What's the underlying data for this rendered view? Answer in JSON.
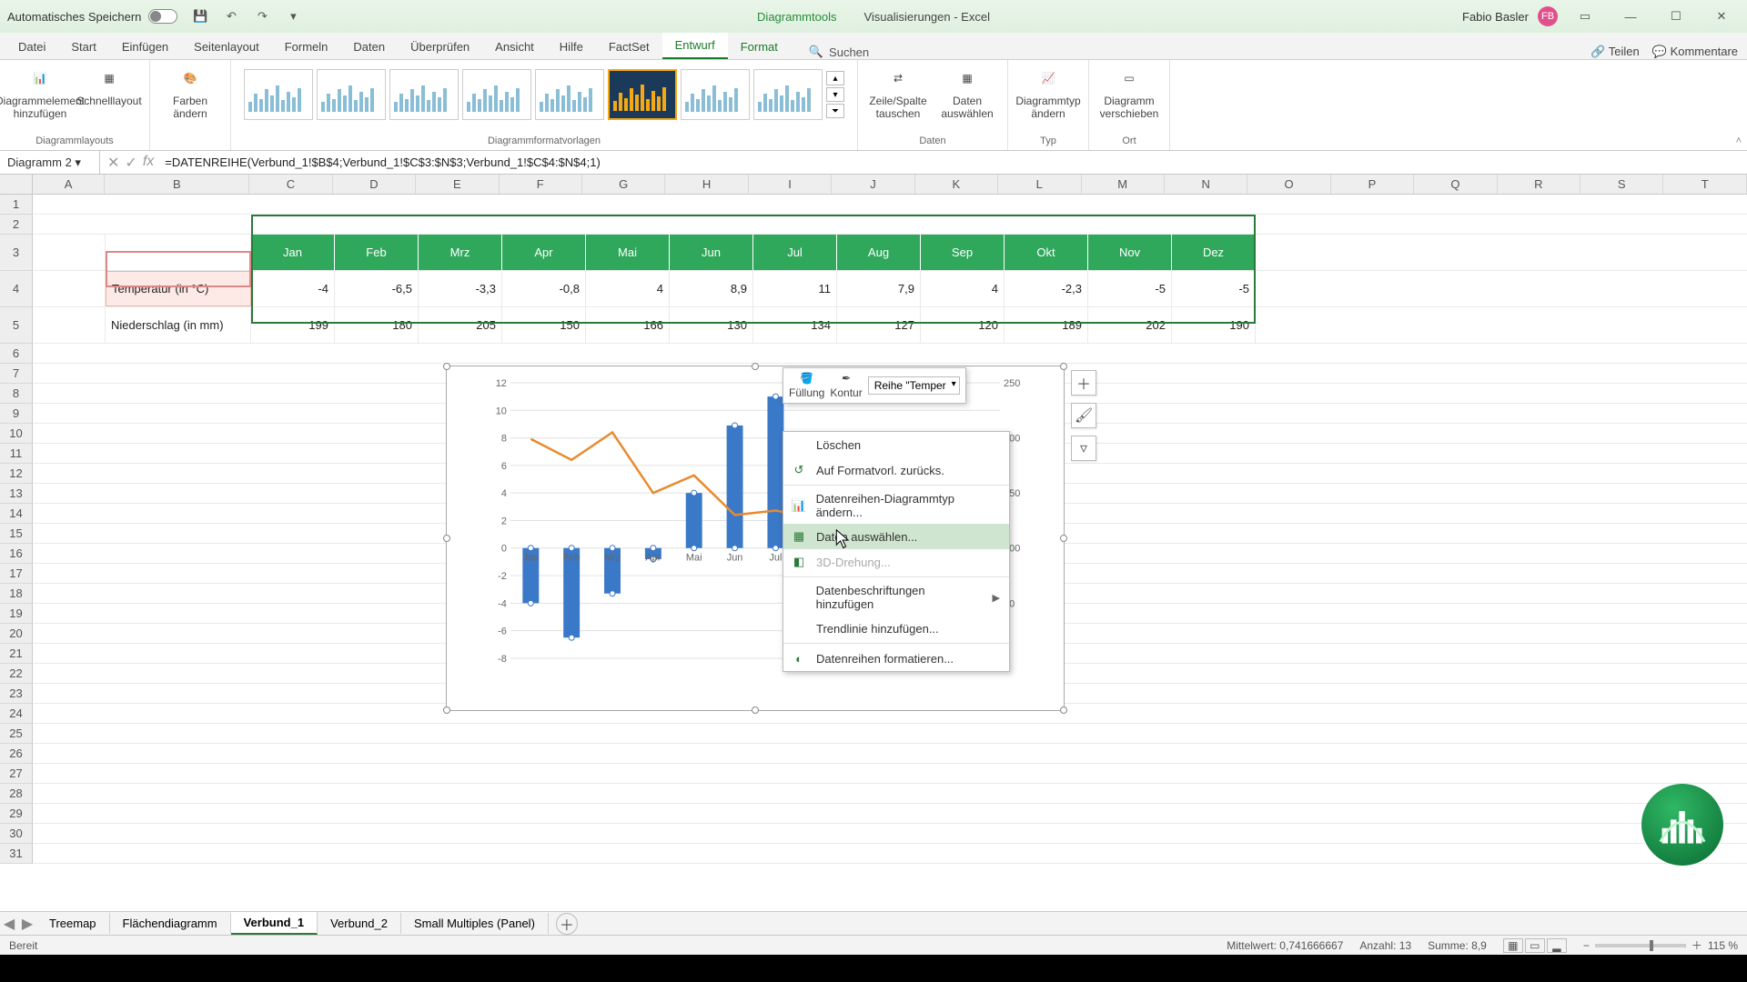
{
  "title": {
    "autosave": "Automatisches Speichern",
    "chart_tools": "Diagrammtools",
    "doc": "Visualisierungen - Excel",
    "user": "Fabio Basler",
    "user_initials": "FB"
  },
  "tabs": [
    "Datei",
    "Start",
    "Einfügen",
    "Seitenlayout",
    "Formeln",
    "Daten",
    "Überprüfen",
    "Ansicht",
    "Hilfe",
    "FactSet",
    "Entwurf",
    "Format"
  ],
  "search_label": "Suchen",
  "share": {
    "teilen": "Teilen",
    "kommentare": "Kommentare"
  },
  "ribbon": {
    "layouts_group": "Diagrammlayouts",
    "add_element": "Diagrammelement hinzufügen",
    "quick_layout": "Schnelllayout",
    "colors": "Farben ändern",
    "styles_group": "Diagrammformatvorlagen",
    "data_group": "Daten",
    "switch": "Zeile/Spalte tauschen",
    "select": "Daten auswählen",
    "type_group": "Typ",
    "change_type": "Diagrammtyp ändern",
    "location_group": "Ort",
    "move": "Diagramm verschieben"
  },
  "namebox": "Diagramm 2",
  "formula": "=DATENREIHE(Verbund_1!$B$4;Verbund_1!$C$3:$N$3;Verbund_1!$C$4:$N$4;1)",
  "columns": [
    "A",
    "B",
    "C",
    "D",
    "E",
    "F",
    "G",
    "H",
    "I",
    "J",
    "K",
    "L",
    "M",
    "N",
    "O",
    "P",
    "Q",
    "R",
    "S",
    "T"
  ],
  "table": {
    "months": [
      "Jan",
      "Feb",
      "Mrz",
      "Apr",
      "Mai",
      "Jun",
      "Jul",
      "Aug",
      "Sep",
      "Okt",
      "Nov",
      "Dez"
    ],
    "row_temp_label": "Temperatur (in °C)",
    "row_precip_label": "Niederschlag (in mm)",
    "temp": [
      "-4",
      "-6,5",
      "-3,3",
      "-0,8",
      "4",
      "8,9",
      "11",
      "7,9",
      "4",
      "-2,3",
      "-5",
      "-5"
    ],
    "precip": [
      "199",
      "180",
      "205",
      "150",
      "166",
      "130",
      "134",
      "127",
      "120",
      "189",
      "202",
      "190"
    ]
  },
  "chart_data": {
    "type": "combo",
    "categories": [
      "Jan",
      "Feb",
      "Mrz",
      "Apr",
      "Mai",
      "Jun",
      "Jul",
      "Aug",
      "Sep",
      "Okt",
      "Nov",
      "Dez"
    ],
    "series": [
      {
        "name": "Temperatur (in °C)",
        "type": "bar",
        "axis": "primary",
        "values": [
          -4,
          -6.5,
          -3.3,
          -0.8,
          4,
          8.9,
          11,
          7.9,
          4,
          -2.3,
          -5,
          -5
        ]
      },
      {
        "name": "Niederschlag (in mm)",
        "type": "line",
        "axis": "secondary",
        "values": [
          199,
          180,
          205,
          150,
          166,
          130,
          134,
          127,
          120,
          189,
          202,
          190
        ]
      }
    ],
    "y_primary": {
      "min": -8,
      "max": 12,
      "ticks": [
        -8,
        -6,
        -4,
        -2,
        0,
        2,
        4,
        6,
        8,
        10,
        12
      ]
    },
    "y_secondary": {
      "min": 0,
      "max": 250,
      "ticks": [
        0,
        50,
        100,
        150,
        200,
        250
      ]
    }
  },
  "mini_toolbar": {
    "fill": "Füllung",
    "outline": "Kontur",
    "series": "Reihe \"Temper"
  },
  "context_menu": {
    "delete": "Löschen",
    "reset": "Auf Formatvorl. zurücks.",
    "change_type": "Datenreihen-Diagrammtyp ändern...",
    "select_data": "Daten auswählen...",
    "three_d": "3D-Drehung...",
    "data_labels": "Datenbeschriftungen hinzufügen",
    "trendline": "Trendlinie hinzufügen...",
    "format": "Datenreihen formatieren..."
  },
  "sheets": [
    "Treemap",
    "Flächendiagramm",
    "Verbund_1",
    "Verbund_2",
    "Small Multiples (Panel)"
  ],
  "status": {
    "ready": "Bereit",
    "avg_label": "Mittelwert:",
    "avg": "0,741666667",
    "count_label": "Anzahl:",
    "count": "13",
    "sum_label": "Summe:",
    "sum": "8,9",
    "zoom": "115 %"
  }
}
